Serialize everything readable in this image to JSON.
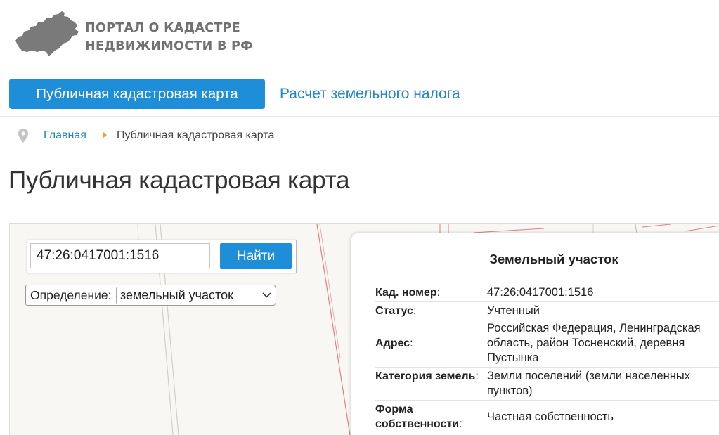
{
  "header": {
    "logo_line1": "ПОРТАЛ О КАДАСТРЕ",
    "logo_line2": "НЕДВИЖИМОСТИ В РФ"
  },
  "nav": {
    "tabs": [
      {
        "label": "Публичная кадастровая карта",
        "active": true
      },
      {
        "label": "Расчет земельного налога",
        "active": false
      }
    ]
  },
  "breadcrumb": {
    "home": "Главная",
    "current": "Публичная кадастровая карта"
  },
  "page": {
    "title": "Публичная кадастровая карта"
  },
  "search": {
    "value": "47:26:0417001:1516",
    "button_label": "Найти"
  },
  "definition": {
    "label": "Определение:",
    "selected": "земельный участок"
  },
  "info_panel": {
    "title": "Земельный участок",
    "rows": [
      {
        "label": "Кад. номер",
        "value": "47:26:0417001:1516"
      },
      {
        "label": "Статус",
        "value": "Учтенный"
      },
      {
        "label": "Адрес",
        "value": "Российская Федерация, Ленинградская область, район Тосненский, деревня Пустынка"
      },
      {
        "label": "Категория земель",
        "value": "Земли поселений (земли населенных пунктов)"
      },
      {
        "label": "Форма собственности",
        "value": "Частная собственность"
      }
    ]
  },
  "colors": {
    "accent": "#1e8ed8",
    "link": "#2384c6",
    "logo_gray": "#717171",
    "breadcrumb_separator": "#f0a020",
    "map_parcel_lines": "#e08080"
  }
}
